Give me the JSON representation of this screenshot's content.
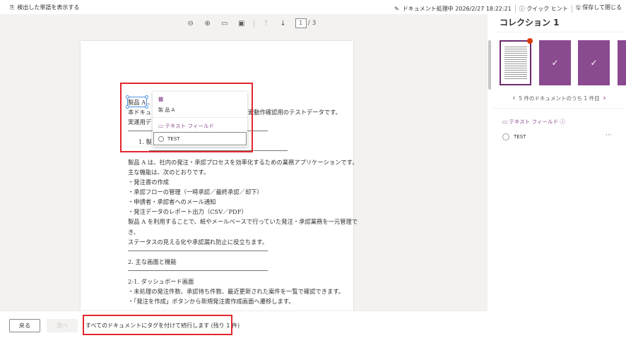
{
  "topbar": {
    "show_words": "検出した単語を表示する",
    "status": "ドキュメント処理中 2026/2/27 18:22:21",
    "quick_hint": "クイック ヒント",
    "save_close": "保存して閉じる"
  },
  "toolbar": {
    "page_current": "1",
    "page_total": "/ 3"
  },
  "document": {
    "lines": [
      "製品 A 、",
      "本ドキュ",
      "索動作確認用のテストデータです。",
      "実運用デ",
      "1.  製",
      "製品 A は、社内の発注・承認プロセスを効率化するための業務アプリケーションです。",
      "主な機能は、次のとおりです。",
      "・発注書の作成",
      "・承認フローの管理（一時承認／最終承認／却下）",
      "・申請者・承認者へのメール通知",
      "・発注データのレポート出力（CSV／PDF）",
      "製品 A を利用することで、紙やメールベースで行っていた発注・承認業務を一元管理で",
      "き、",
      "ステータスの見える化や承認漏れ防止に役立ちます。",
      "2. 主な画面と機能",
      "2-1. ダッシュボード画面",
      "・未処理の発注件数、承認待ち件数、最近更新された案件を一覧で確認できます。",
      "・「発注を作成」ボタンから新規発注書作成画面へ遷移します。"
    ]
  },
  "popup": {
    "value_label": "値",
    "value": "製 品 A",
    "field_label": "テキスト フィールド",
    "option": "TEST"
  },
  "side": {
    "title": "コレクション 1",
    "pager": "5 件のドキュメントのうち 1 件目",
    "field_label": "テキスト フィールド",
    "tag": "TEST",
    "more": "···"
  },
  "bottom": {
    "back": "戻る",
    "next": "次へ",
    "tag_all": "すべてのドキュメントにタグを付けて続行します (残り 1 件)"
  },
  "colors": {
    "accent": "#8a4a8f",
    "highlight": "#e3262d"
  }
}
